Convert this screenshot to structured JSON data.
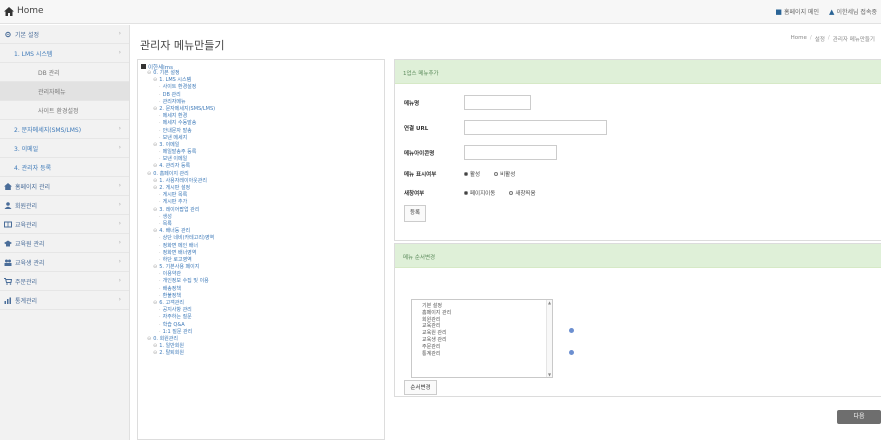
{
  "topbar": {
    "home_label": "Home",
    "link_homepage": "홈페이지 메인",
    "link_user": "이한세님 접속중"
  },
  "sidebar": {
    "items": [
      {
        "label": "기본 설정",
        "level": 0,
        "icon": "gear-icon"
      },
      {
        "label": "1. LMS 시스템",
        "level": 1
      },
      {
        "label": "DB 관리",
        "level": 2
      },
      {
        "label": "관리자메뉴",
        "level": 2,
        "active": true
      },
      {
        "label": "사이트 환경설정",
        "level": 2
      },
      {
        "label": "2. 문자메세지(SMS/LMS)",
        "level": 1
      },
      {
        "label": "3. 이메일",
        "level": 1
      },
      {
        "label": "4. 관리자 등록",
        "level": 1
      },
      {
        "label": "홈페이지 관리",
        "level": 0,
        "icon": "home-icon"
      },
      {
        "label": "회원관리",
        "level": 0,
        "icon": "user-icon"
      },
      {
        "label": "교육관리",
        "level": 0,
        "icon": "book-icon"
      },
      {
        "label": "교육원 관리",
        "level": 0,
        "icon": "school-icon"
      },
      {
        "label": "교육생 관리",
        "level": 0,
        "icon": "users-icon"
      },
      {
        "label": "주문관리",
        "level": 0,
        "icon": "cart-icon"
      },
      {
        "label": "통계관리",
        "level": 0,
        "icon": "chart-icon"
      }
    ]
  },
  "main": {
    "title": "관리자 메뉴만들기",
    "breadcrumb": [
      "Home",
      "설정",
      "관리자 메뉴만들기"
    ]
  },
  "tree": {
    "root_label": "이한세lms",
    "nodes": [
      "- 0. 기본 설정",
      "-- 1. LMS 시스템",
      "--- 사이트 환경설정",
      "--- DB 관리",
      "--- 관리자메뉴",
      "-- 2. 문자메세지(SMS/LMS)",
      "--- 메세지 환경",
      "--- 메세지 수동발송",
      "--- 안내문자 발송",
      "--- 보낸 메세지",
      "-- 3. 이메일",
      "--- 메일발송주 등록",
      "--- 보낸 이메일",
      "-- 4. 관리자 등록",
      "- 0. 홈페이지 관리",
      "-- 1. 사용자레이아웃관리",
      "-- 2. 게시판 설정",
      "--- 게시판 목록",
      "--- 게시판 추가",
      "-- 3. 레이어팝업 관리",
      "--- 생성",
      "--- 목록",
      "-- 4. 배너등 관리",
      "--- 상단 네비(카테고리)영역",
      "--- 정화면 메인 배너",
      "--- 정화면 배너영역",
      "--- 하단 로고영역",
      "-- 5. 기본사용 페이지",
      "--- 이용약관",
      "--- 개인정보 수집 및 이용",
      "--- 배송정책",
      "--- 환불정책",
      "-- 6. 고객관리",
      "--- 공지사항 관리",
      "--- 자주하는 질문",
      "--- 학습 Q&A",
      "--- 1:1 질문 관리",
      "- 0. 회원관리",
      "-- 1. 일반회원",
      "-- 2. 탈퇴회원"
    ]
  },
  "add_panel": {
    "title": "1업스 메뉴추가",
    "menu_name_label": "메뉴명",
    "menu_name_value": "",
    "url_label": "연결 URL",
    "url_value": "",
    "icon_label": "메뉴아이콘명",
    "icon_value": "",
    "display_label": "메뉴 표시여부",
    "display_on": "활성",
    "display_off": "비활성",
    "window_label": "새창여부",
    "window_same": "페이지이동",
    "window_new": "새창띄움",
    "submit_label": "등록"
  },
  "order_panel": {
    "title": "메뉴 순서변경",
    "options": [
      "기본 설정",
      "홈페이지 관리",
      "회원관리",
      "교육관리",
      "교육원 관리",
      "교육생 관리",
      "주문관리",
      "통계관리"
    ],
    "submit_label": "순서변경"
  },
  "next_button_label": "다음",
  "colors": {
    "panel_head_bg": "#dff0d8",
    "link_blue": "#3d79b8"
  }
}
